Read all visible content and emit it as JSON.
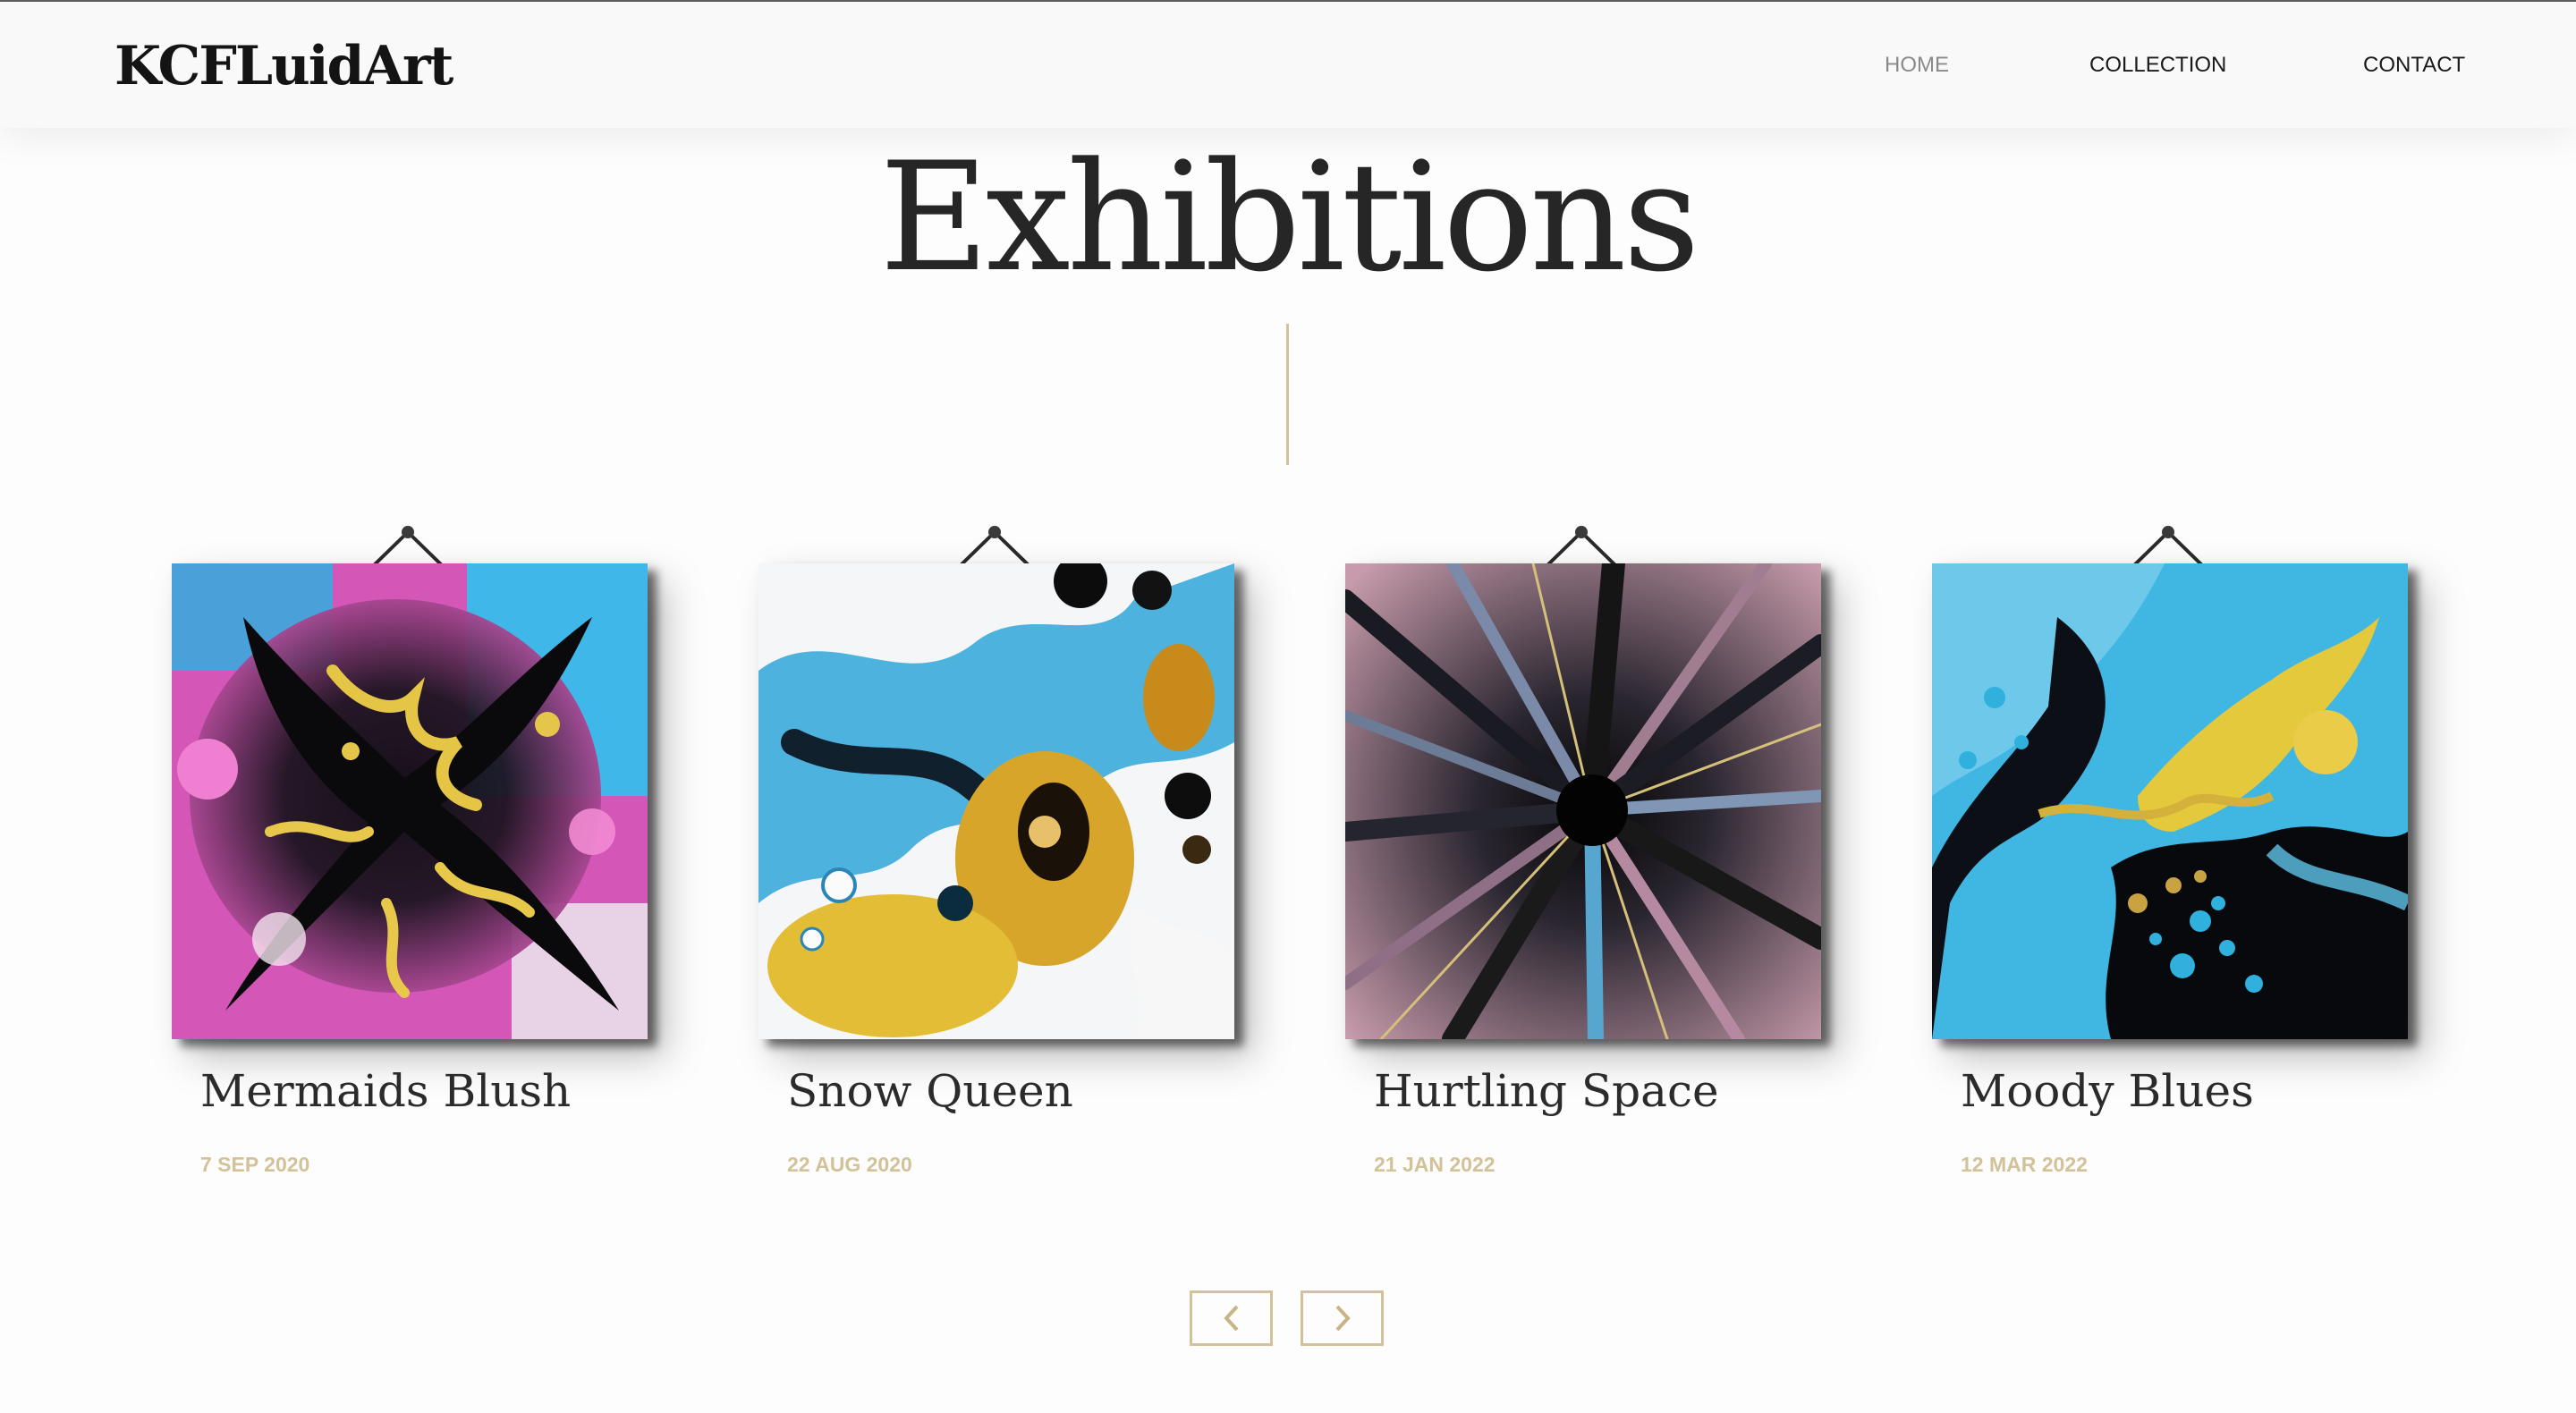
{
  "header": {
    "logo": "KCFLuidArt",
    "nav": [
      {
        "label": "HOME",
        "active": true
      },
      {
        "label": "COLLECTION",
        "active": false
      },
      {
        "label": "CONTACT",
        "active": false
      }
    ]
  },
  "page": {
    "title": "Exhibitions"
  },
  "artworks": [
    {
      "title": "Mermaids Blush",
      "date": "7 SEP 2020"
    },
    {
      "title": "Snow Queen",
      "date": "22 AUG 2020"
    },
    {
      "title": "Hurtling Space",
      "date": "21 JAN 2022"
    },
    {
      "title": "Moody Blues",
      "date": "12 MAR 2022"
    }
  ],
  "pager": {
    "prev_icon": "chevron-left-icon",
    "next_icon": "chevron-right-icon"
  },
  "colors": {
    "accent_gold": "#d3c197",
    "text_dark": "#262626",
    "nav_inactive": "#1a1a1a",
    "nav_active": "#8a8a8a",
    "background": "#fdfdfd"
  }
}
